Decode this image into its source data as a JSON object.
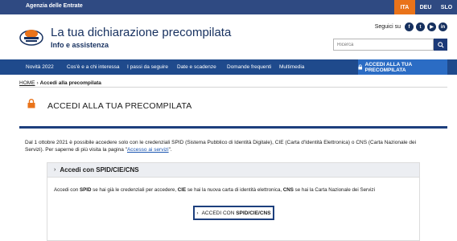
{
  "topbar": {
    "agency": "Agenzia delle Entrate",
    "languages": [
      "ITA",
      "DEU",
      "SLO"
    ],
    "active_language": "ITA",
    "accent_color": "#e9731a"
  },
  "header": {
    "title": "La tua dichiarazione precompilata",
    "subtitle": "Info e assistenza",
    "follow_label": "Seguici su",
    "social": [
      "f",
      "t",
      "▶",
      "in"
    ],
    "search_placeholder": "Ricerca"
  },
  "nav": {
    "items": [
      "Novità 2022",
      "Cos'è e a chi interessa",
      "I passi da seguire",
      "Date e scadenze",
      "Domande frequenti",
      "Multimedia"
    ],
    "cta": "ACCEDI ALLA TUA PRECOMPILATA"
  },
  "breadcrumb": {
    "home": "HOME",
    "separator": "›",
    "current": "Accedi alla precompilata"
  },
  "page": {
    "title": "ACCEDI ALLA TUA PRECOMPILATA"
  },
  "intro": {
    "text": "Dal 1 ottobre 2021 è possibile accedere solo con le credenziali SPID (Sistema Pubblico di Identità Digitale), CIE (Carta d'Identità Elettronica) o CNS (Carta Nazionale dei Servizi). Per saperne di più visita la pagina \"",
    "link": "Accesso ai servizi",
    "suffix": "\"."
  },
  "accordion": {
    "chevron": "›",
    "title": "Accedi con SPID/CIE/CNS",
    "body_1": "Accedi con ",
    "body_spid": "SPID",
    "body_2": " se hai già le credenziali per accedere, ",
    "body_cie": "CIE",
    "body_3": " se hai la nuova carta di identità elettronica, ",
    "body_cns": "CNS",
    "body_4": " se hai la Carta Nazionale dei Servizi",
    "button_prefix": "ACCEDI CON ",
    "button_bold": "SPID/CIE/CNS"
  }
}
